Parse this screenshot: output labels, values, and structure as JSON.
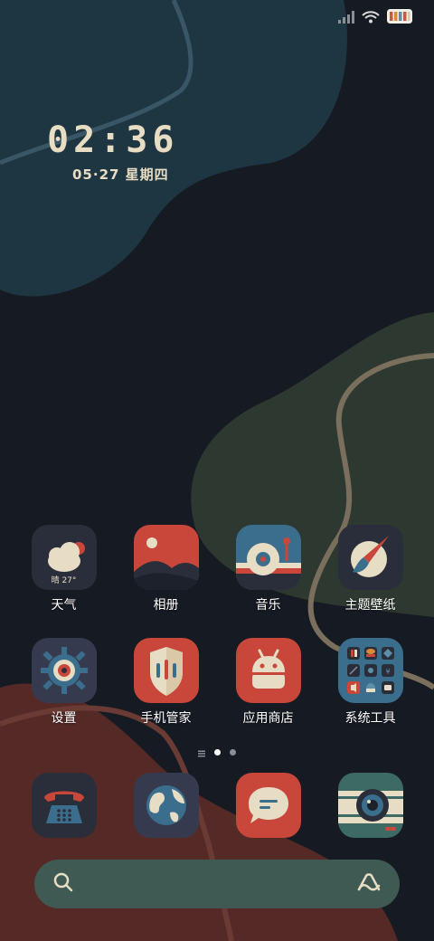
{
  "status_bar": {
    "signal_icon": "signal-icon",
    "wifi_icon": "wifi-icon",
    "battery_icon": "battery-icon",
    "battery_colors": [
      "#d9c9a8",
      "#c45a44",
      "#d98b3c",
      "#5d8fa8",
      "#e7dcc4"
    ]
  },
  "lock_widget": {
    "time": "02:36",
    "date": "05·27 星期四"
  },
  "apps_row1": [
    {
      "label": "天气",
      "icon": "weather-icon",
      "badge": "晴 27°"
    },
    {
      "label": "相册",
      "icon": "gallery-icon"
    },
    {
      "label": "音乐",
      "icon": "music-icon"
    },
    {
      "label": "主题壁纸",
      "icon": "theme-icon"
    }
  ],
  "apps_row2": [
    {
      "label": "设置",
      "icon": "settings-icon"
    },
    {
      "label": "手机管家",
      "icon": "phone-manager-icon"
    },
    {
      "label": "应用商店",
      "icon": "app-store-icon"
    },
    {
      "label": "系统工具",
      "icon": "system-tools-folder-icon"
    }
  ],
  "page_indicator": {
    "current": 2,
    "total": 3
  },
  "dock": [
    {
      "name": "phone",
      "icon": "telephone-icon"
    },
    {
      "name": "browser",
      "icon": "globe-icon"
    },
    {
      "name": "messages",
      "icon": "message-icon"
    },
    {
      "name": "camera",
      "icon": "camera-icon"
    }
  ],
  "search": {
    "search_icon": "search-icon",
    "assistant_icon": "assistant-icon"
  },
  "colors": {
    "background": "#161a23",
    "teal_blob": "#1e3641",
    "green_blob": "#2c3830",
    "red_blob": "#552a26",
    "text": "#e7dcc4",
    "accent_red": "#c9473a",
    "accent_blue": "#3b6e8c",
    "search_bg": "#3e5a53"
  }
}
